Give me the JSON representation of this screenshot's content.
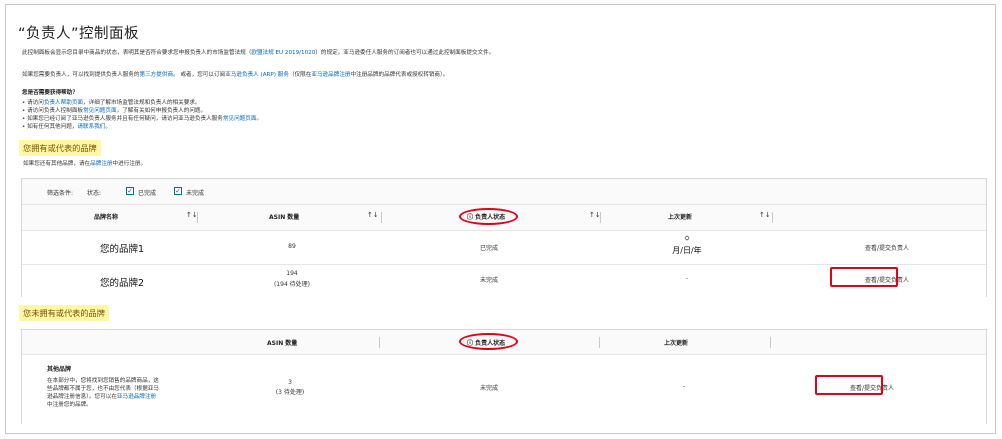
{
  "page": {
    "title": "“负责人”控制面板",
    "intro_a": "此控制面板会显示您目录中商品的状态，表明其是否符合要求您申报负责人的市场监管法规（",
    "intro_link": "欧盟法规 EU 2019/1020",
    "intro_b": "）的规定。亚马逊委任人服务的订阅者也可以通过此控制面板提交文件。",
    "line2_a": "如果您需要负责人，可以找到提供负责人服务的",
    "line2_link1": "第三方提供商",
    "line2_b": "。 或者，您可以订阅",
    "line2_link2": "亚马逊负责人 (ARP) 服务",
    "line2_c": "（仅限在",
    "line2_link3": "亚马逊品牌注册",
    "line2_d": "中注册品牌的品牌代表或授权转销商）。",
    "help_heading": "您是否需要获得帮助？",
    "help_items": [
      {
        "a": "• 请访问",
        "link": "负责人帮助页面",
        "b": "，详细了解市场监管法规和负责人的相关要求。"
      },
      {
        "a": "• 请访问负责人控制面板",
        "link": "常见问题页面",
        "b": "，了解有关如何申报负责人的问题。"
      },
      {
        "a": "• 如果您已经订阅了亚马逊负责人服务并且有任何疑问，请访问亚马逊负责人服务",
        "link": "常见问题页面",
        "b": "。"
      },
      {
        "a": "• 如有任何其他问题，",
        "link": "请联系我们",
        "b": "。"
      }
    ]
  },
  "owned": {
    "heading": "您拥有或代表的品牌",
    "note_a": "如果您还有其他品牌，请在",
    "note_link": "品牌注册",
    "note_b": "中进行注册。",
    "filter_label": "筛选条件:",
    "status_label": "状态:",
    "filter_complete": "已完成",
    "filter_incomplete": "未完成",
    "check_mark": "✓",
    "sort_glyph": "↑↓",
    "columns": {
      "brand": "品牌名称",
      "asin": "ASIN 数量",
      "status": "负责人状态",
      "updated": "上次更新"
    },
    "info_glyph": "ⓘ",
    "rows": [
      {
        "brand": "您的品牌1",
        "asin": "89",
        "asin_sub": "",
        "status": "已完成",
        "updated_icon": "⛭",
        "updated": "月/日/年",
        "action": "查看/提交负责人"
      },
      {
        "brand": "您的品牌2",
        "asin": "194",
        "asin_sub": "(194 待处理)",
        "status": "未完成",
        "updated_icon": "",
        "updated": "-",
        "action": "查看/提交负责人"
      }
    ]
  },
  "unowned": {
    "heading": "您未拥有或代表的品牌",
    "columns": {
      "asin": "ASIN 数量",
      "status": "负责人状态",
      "updated": "上次更新"
    },
    "row": {
      "title": "其他品牌",
      "desc1": "在本部分中，您将找到您销售的品牌商品，这",
      "desc2": "些品牌都不属于您，也不由您代表（根据亚马",
      "desc3a": "逊品牌注册信息）。您可以在",
      "desc3link": "亚马逊品牌注册",
      "desc4": "中注册您的品牌。",
      "asin": "3",
      "asin_sub": "(3 待处理)",
      "status": "未完成",
      "updated": "-",
      "action": "查看/提交负责人"
    }
  },
  "colors": {
    "link": "#0066c0",
    "highlight": "#fdf7a6",
    "annotation": "#e3001b"
  }
}
